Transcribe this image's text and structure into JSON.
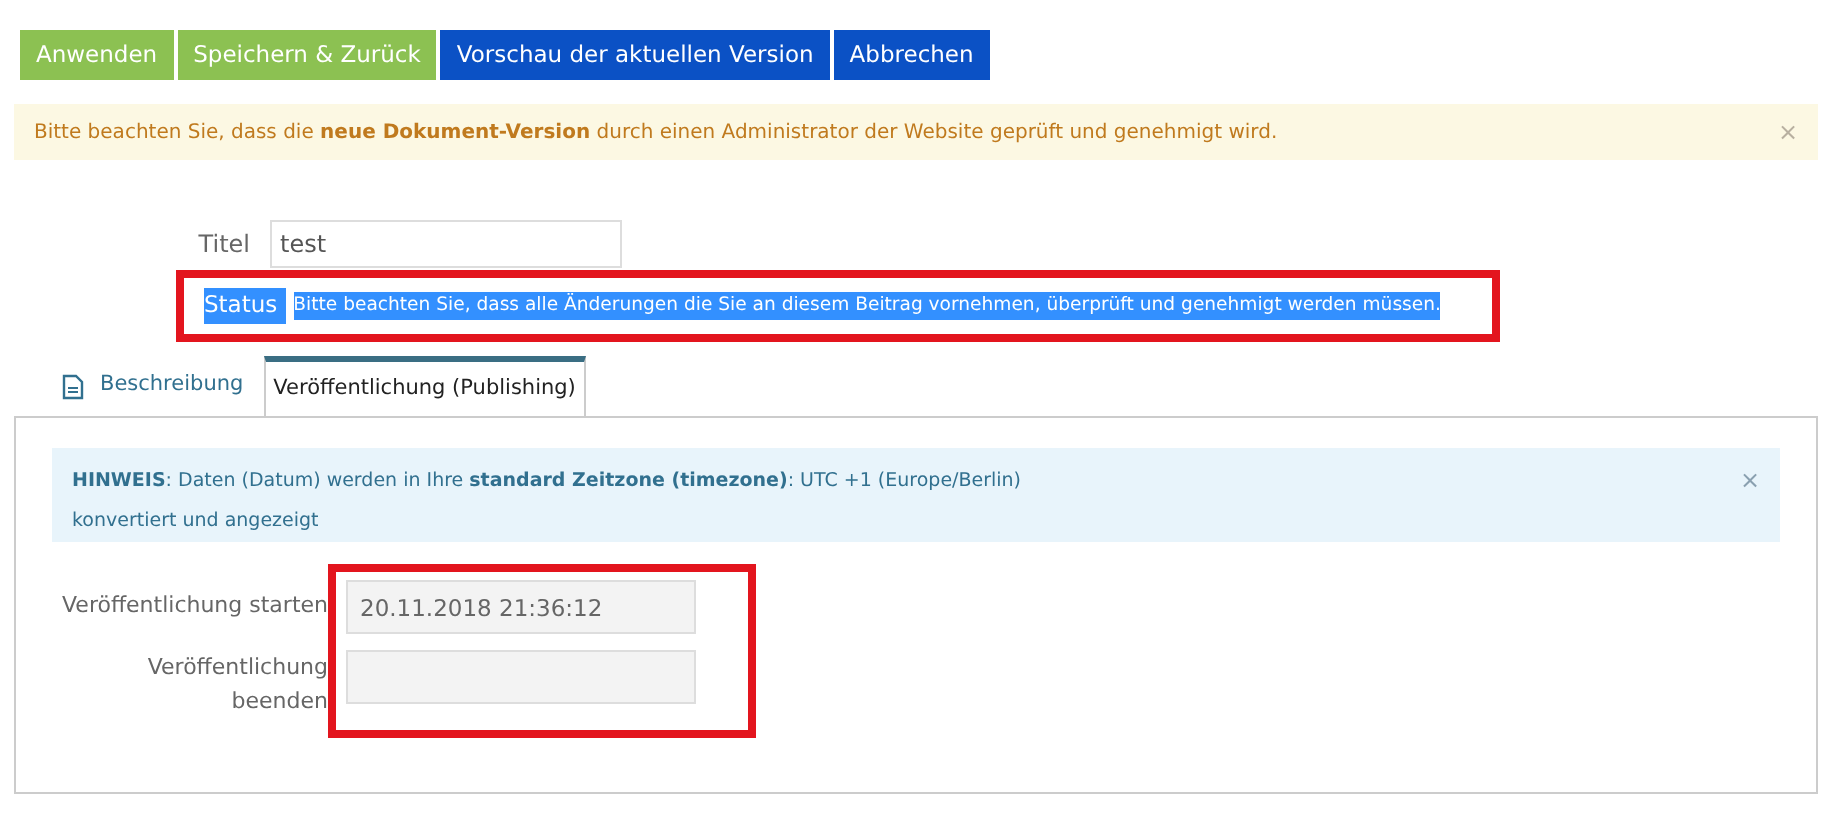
{
  "toolbar": [
    {
      "label": "Anwenden",
      "kind": "success"
    },
    {
      "label": "Speichern & Zurück",
      "kind": "success"
    },
    {
      "label": "Vorschau der aktuellen Version",
      "kind": "primary"
    },
    {
      "label": "Abbrechen",
      "kind": "primary"
    }
  ],
  "warning": {
    "text": "Bitte beachten Sie, dass die **neue Dokument-Version** durch einen Administrator der Website geprüft und genehmigt wird.",
    "close": "×"
  },
  "title_field": {
    "label": "Titel",
    "value": "test"
  },
  "status": {
    "label": "Status",
    "text": "Bitte beachten Sie, dass alle Änderungen die Sie an diesem Beitrag vornehmen, überprüft und genehmigt werden müssen.",
    "highlighted": true
  },
  "tabs": [
    {
      "label": "Beschreibung",
      "selected": false
    },
    {
      "label": "Veröffentlichung (Publishing)",
      "selected": true
    }
  ],
  "info": {
    "text": "**HINWEIS**: Daten (Datum) werden in Ihre **standard Zeitzone (timezone)**: UTC +1 (Europe/Berlin) konvertiert und angezeigt",
    "close": "×"
  },
  "fields": [
    {
      "label": "Veröffentlichung starten",
      "value": "20.11.2018 21:36:12"
    },
    {
      "label": "Veröffentlichung beenden"
    }
  ]
}
